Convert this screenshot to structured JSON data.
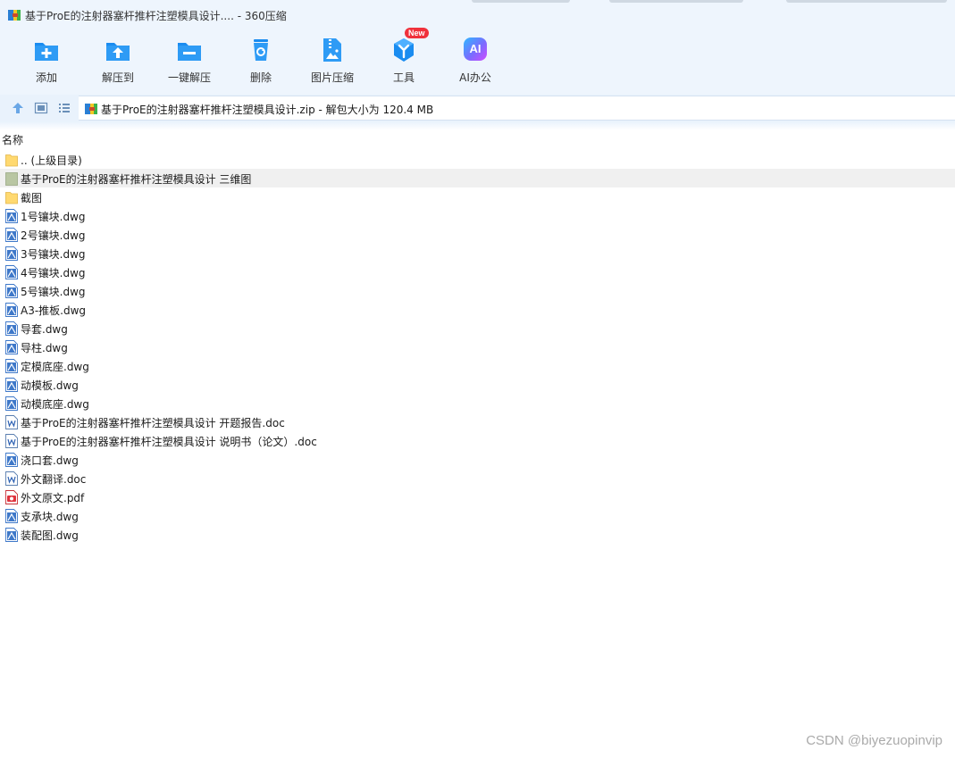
{
  "window": {
    "title": "基于ProE的注射器塞杆推杆注塑模具设计.... - 360压缩"
  },
  "toolbar": {
    "add": "添加",
    "extract_to": "解压到",
    "one_click_extract": "一键解压",
    "delete": "删除",
    "image_compress": "图片压缩",
    "tools": "工具",
    "tools_badge": "New",
    "ai_office": "AI办公",
    "ai_icon_text": "AI"
  },
  "address": {
    "path": "基于ProE的注射器塞杆推杆注塑模具设计.zip - 解包大小为 120.4 MB"
  },
  "list": {
    "column_name": "名称",
    "items": [
      {
        "name": ".. (上级目录)",
        "type": "folder"
      },
      {
        "name": "基于ProE的注射器塞杆推杆注塑模具设计 三维图",
        "type": "folder-selected"
      },
      {
        "name": "截图",
        "type": "folder"
      },
      {
        "name": "1号镶块.dwg",
        "type": "dwg"
      },
      {
        "name": "2号镶块.dwg",
        "type": "dwg"
      },
      {
        "name": "3号镶块.dwg",
        "type": "dwg"
      },
      {
        "name": "4号镶块.dwg",
        "type": "dwg"
      },
      {
        "name": "5号镶块.dwg",
        "type": "dwg"
      },
      {
        "name": "A3-推板.dwg",
        "type": "dwg"
      },
      {
        "name": "导套.dwg",
        "type": "dwg"
      },
      {
        "name": "导柱.dwg",
        "type": "dwg"
      },
      {
        "name": "定模底座.dwg",
        "type": "dwg"
      },
      {
        "name": "动模板.dwg",
        "type": "dwg"
      },
      {
        "name": "动模底座.dwg",
        "type": "dwg"
      },
      {
        "name": "基于ProE的注射器塞杆推杆注塑模具设计 开题报告.doc",
        "type": "doc"
      },
      {
        "name": "基于ProE的注射器塞杆推杆注塑模具设计 说明书（论文）.doc",
        "type": "doc"
      },
      {
        "name": "浇口套.dwg",
        "type": "dwg"
      },
      {
        "name": "外文翻译.doc",
        "type": "doc"
      },
      {
        "name": "外文原文.pdf",
        "type": "pdf"
      },
      {
        "name": "支承块.dwg",
        "type": "dwg"
      },
      {
        "name": "装配图.dwg",
        "type": "dwg"
      }
    ]
  },
  "watermark": "CSDN @biyezuopinvip",
  "colors": {
    "accent_blue": "#1a8cf0",
    "folder_yellow": "#ffd970",
    "badge_red": "#f0313b",
    "ai_gradient_start": "#2fb8ff",
    "ai_gradient_end": "#b04cff"
  }
}
